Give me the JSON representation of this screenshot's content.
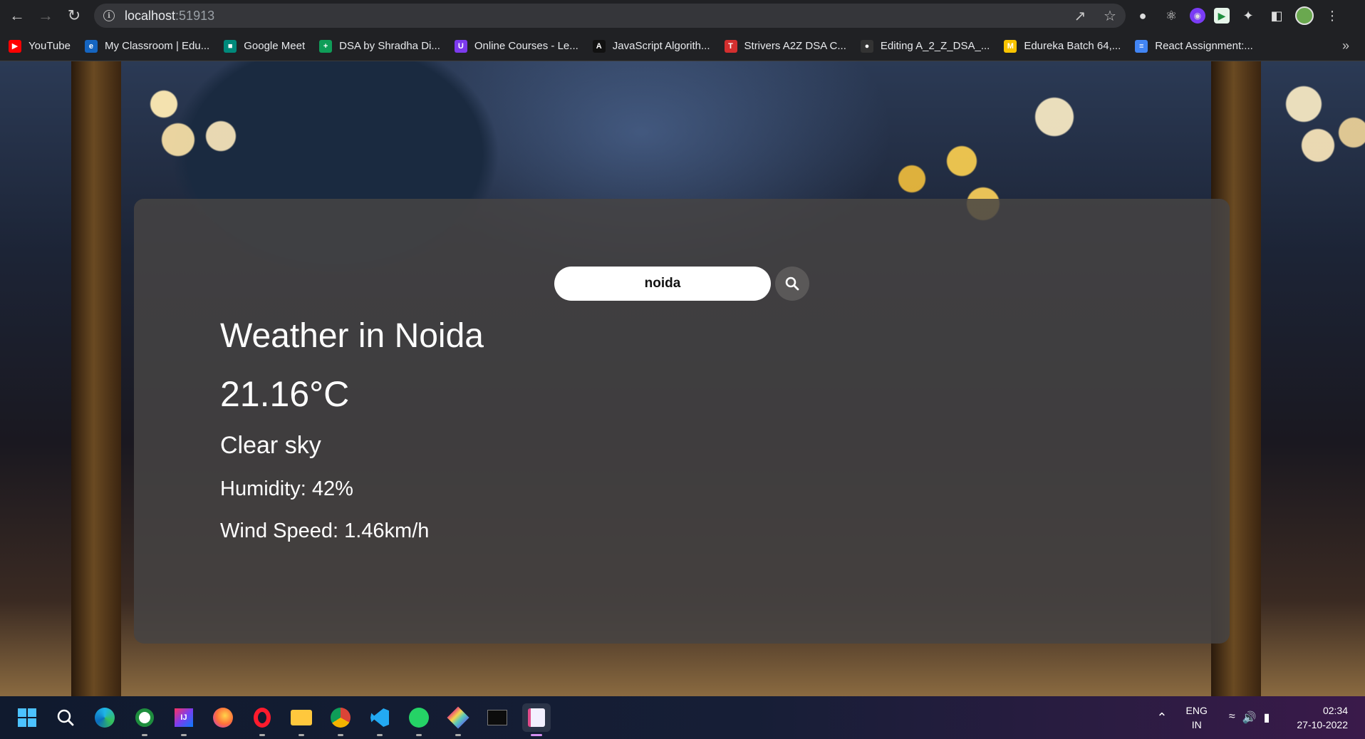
{
  "browser": {
    "url_host": "localhost",
    "url_port": ":51913",
    "bookmarks": [
      {
        "label": "YouTube",
        "color": "#ff0000",
        "glyph": "▶"
      },
      {
        "label": "My Classroom | Edu...",
        "color": "#1565c0",
        "glyph": "e"
      },
      {
        "label": "Google Meet",
        "color": "#00897b",
        "glyph": "■"
      },
      {
        "label": "DSA by Shradha Di...",
        "color": "#0f9d58",
        "glyph": "+"
      },
      {
        "label": "Online Courses - Le...",
        "color": "#7c3aed",
        "glyph": "U"
      },
      {
        "label": "JavaScript Algorith...",
        "color": "#111111",
        "glyph": "A"
      },
      {
        "label": "Strivers A2Z DSA C...",
        "color": "#d32f2f",
        "glyph": "T"
      },
      {
        "label": "Editing A_2_Z_DSA_...",
        "color": "#333333",
        "glyph": "●"
      },
      {
        "label": "Edureka Batch 64,...",
        "color": "#f9c400",
        "glyph": "M"
      },
      {
        "label": "React Assignment:...",
        "color": "#4285f4",
        "glyph": "≡"
      }
    ]
  },
  "app": {
    "search": {
      "value": "noida"
    },
    "weather": {
      "city_heading": "Weather in Noida",
      "temperature": "21.16°C",
      "description": "Clear sky",
      "humidity": "Humidity: 42%",
      "wind": "Wind Speed: 1.46km/h"
    }
  },
  "taskbar": {
    "lang_top": "ENG",
    "lang_bottom": "IN",
    "time": "02:34",
    "date": "27-10-2022"
  }
}
